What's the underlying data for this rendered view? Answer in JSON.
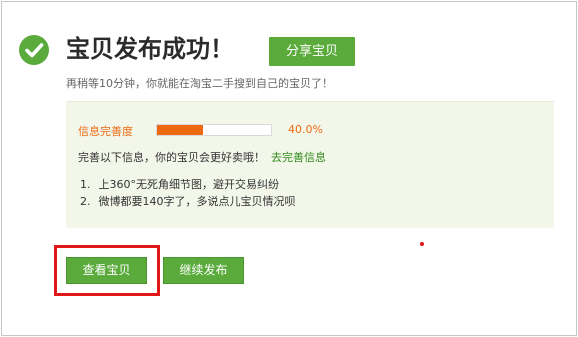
{
  "header": {
    "title": "宝贝发布成功！",
    "share_label": "分享宝贝",
    "subtitle": "再稍等10分钟，你就能在淘宝二手搜到自己的宝贝了！"
  },
  "info": {
    "progress_label": "信息完善度",
    "progress_value": 0.4,
    "progress_text": "40.0%",
    "improve_text": "完善以下信息，你的宝贝会更好卖哦！",
    "improve_link": "去完善信息",
    "tips": [
      {
        "num": "1.",
        "text": "上360°无死角细节图，避开交易纠纷"
      },
      {
        "num": "2.",
        "text": "微博都要140字了，多说点儿宝贝情况呗"
      }
    ]
  },
  "actions": {
    "view_label": "查看宝贝",
    "continue_label": "继续发布"
  },
  "colors": {
    "accent_green": "#5aab3c",
    "progress_orange": "#ee6a12",
    "highlight_red": "#e01818"
  }
}
